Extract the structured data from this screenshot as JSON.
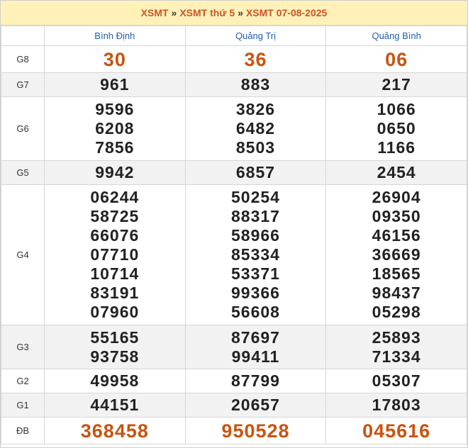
{
  "breadcrumb": {
    "items": [
      "XSMT",
      "XSMT thứ 5",
      "XSMT 07-08-2025"
    ],
    "separator": "»"
  },
  "columns": [
    "Bình Định",
    "Quảng Trị",
    "Quảng Bình"
  ],
  "prizes": [
    {
      "label": "G8",
      "values": [
        [
          "30"
        ],
        [
          "36"
        ],
        [
          "06"
        ]
      ]
    },
    {
      "label": "G7",
      "values": [
        [
          "961"
        ],
        [
          "883"
        ],
        [
          "217"
        ]
      ]
    },
    {
      "label": "G6",
      "values": [
        [
          "9596",
          "6208",
          "7856"
        ],
        [
          "3826",
          "6482",
          "8503"
        ],
        [
          "1066",
          "0650",
          "1166"
        ]
      ]
    },
    {
      "label": "G5",
      "values": [
        [
          "9942"
        ],
        [
          "6857"
        ],
        [
          "2454"
        ]
      ]
    },
    {
      "label": "G4",
      "values": [
        [
          "06244",
          "58725",
          "66076",
          "07710",
          "10714",
          "83191",
          "07960"
        ],
        [
          "50254",
          "88317",
          "58966",
          "85334",
          "53371",
          "99366",
          "56608"
        ],
        [
          "26904",
          "09350",
          "46156",
          "36669",
          "18565",
          "98437",
          "05298"
        ]
      ]
    },
    {
      "label": "G3",
      "values": [
        [
          "55165",
          "93758"
        ],
        [
          "87697",
          "99411"
        ],
        [
          "25893",
          "71334"
        ]
      ]
    },
    {
      "label": "G2",
      "values": [
        [
          "49958"
        ],
        [
          "87799"
        ],
        [
          "05307"
        ]
      ]
    },
    {
      "label": "G1",
      "values": [
        [
          "44151"
        ],
        [
          "20657"
        ],
        [
          "17803"
        ]
      ]
    },
    {
      "label": "ĐB",
      "values": [
        [
          "368458"
        ],
        [
          "950528"
        ],
        [
          "045616"
        ]
      ]
    }
  ],
  "colors": {
    "accent": "#c9530f",
    "header_bg": "#fff1b8",
    "column_header": "#1f5fb0",
    "alt_row": "#f2f2f2"
  }
}
